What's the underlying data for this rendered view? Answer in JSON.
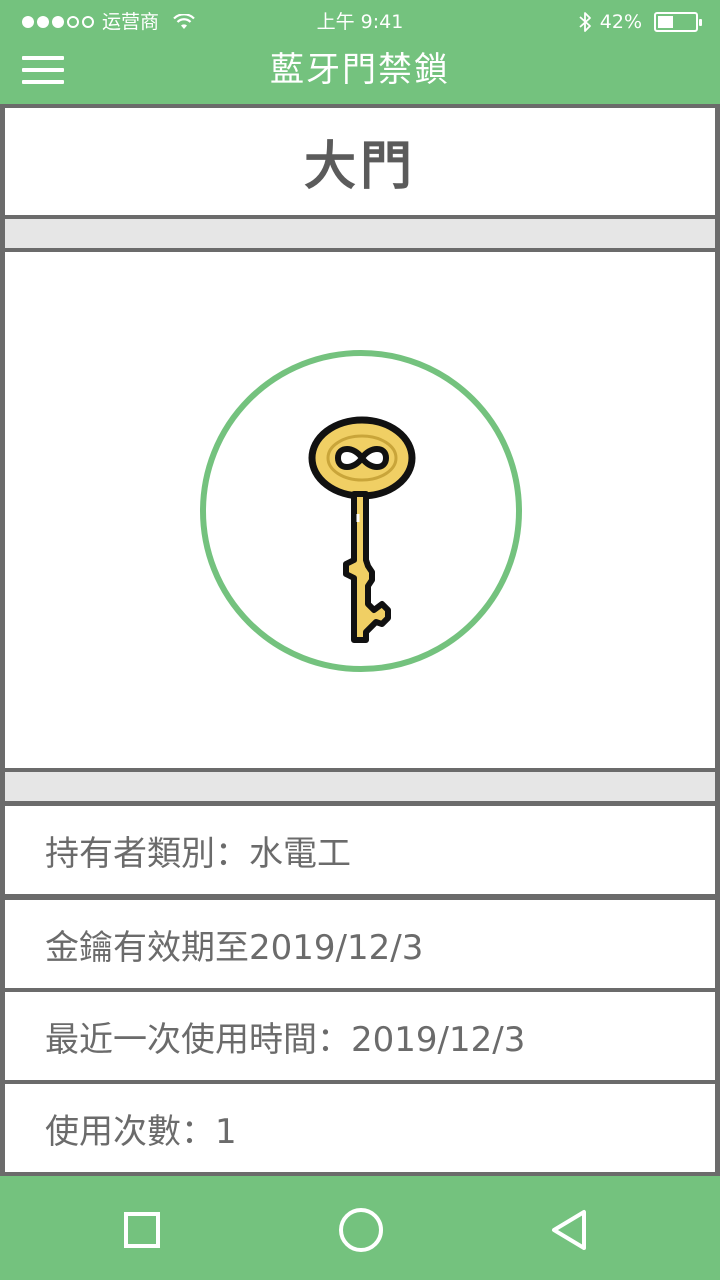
{
  "status_bar": {
    "carrier": "运营商",
    "time": "上午 9:41",
    "battery_percent": "42%",
    "battery_level": 0.42,
    "signal_dots_filled": 3,
    "signal_dots_total": 5
  },
  "header": {
    "title": "藍牙門禁鎖",
    "menu_icon": "hamburger-menu-icon"
  },
  "door": {
    "name": "大門",
    "key_icon": "key-icon"
  },
  "info": {
    "holder_type": "持有者類別：水電工",
    "valid_until": "金鑰有效期至2019/12/3",
    "last_used": "最近一次使用時間：2019/12/3",
    "use_count": "使用次數：1"
  },
  "bottom_nav": {
    "icons": [
      "square-recents-icon",
      "circle-home-icon",
      "triangle-back-icon"
    ]
  },
  "colors": {
    "accent_green": "#74c27e",
    "key_gold": "#f0cf64",
    "text_gray": "#6b6b6b",
    "separator_gray": "#e6e6e6"
  }
}
